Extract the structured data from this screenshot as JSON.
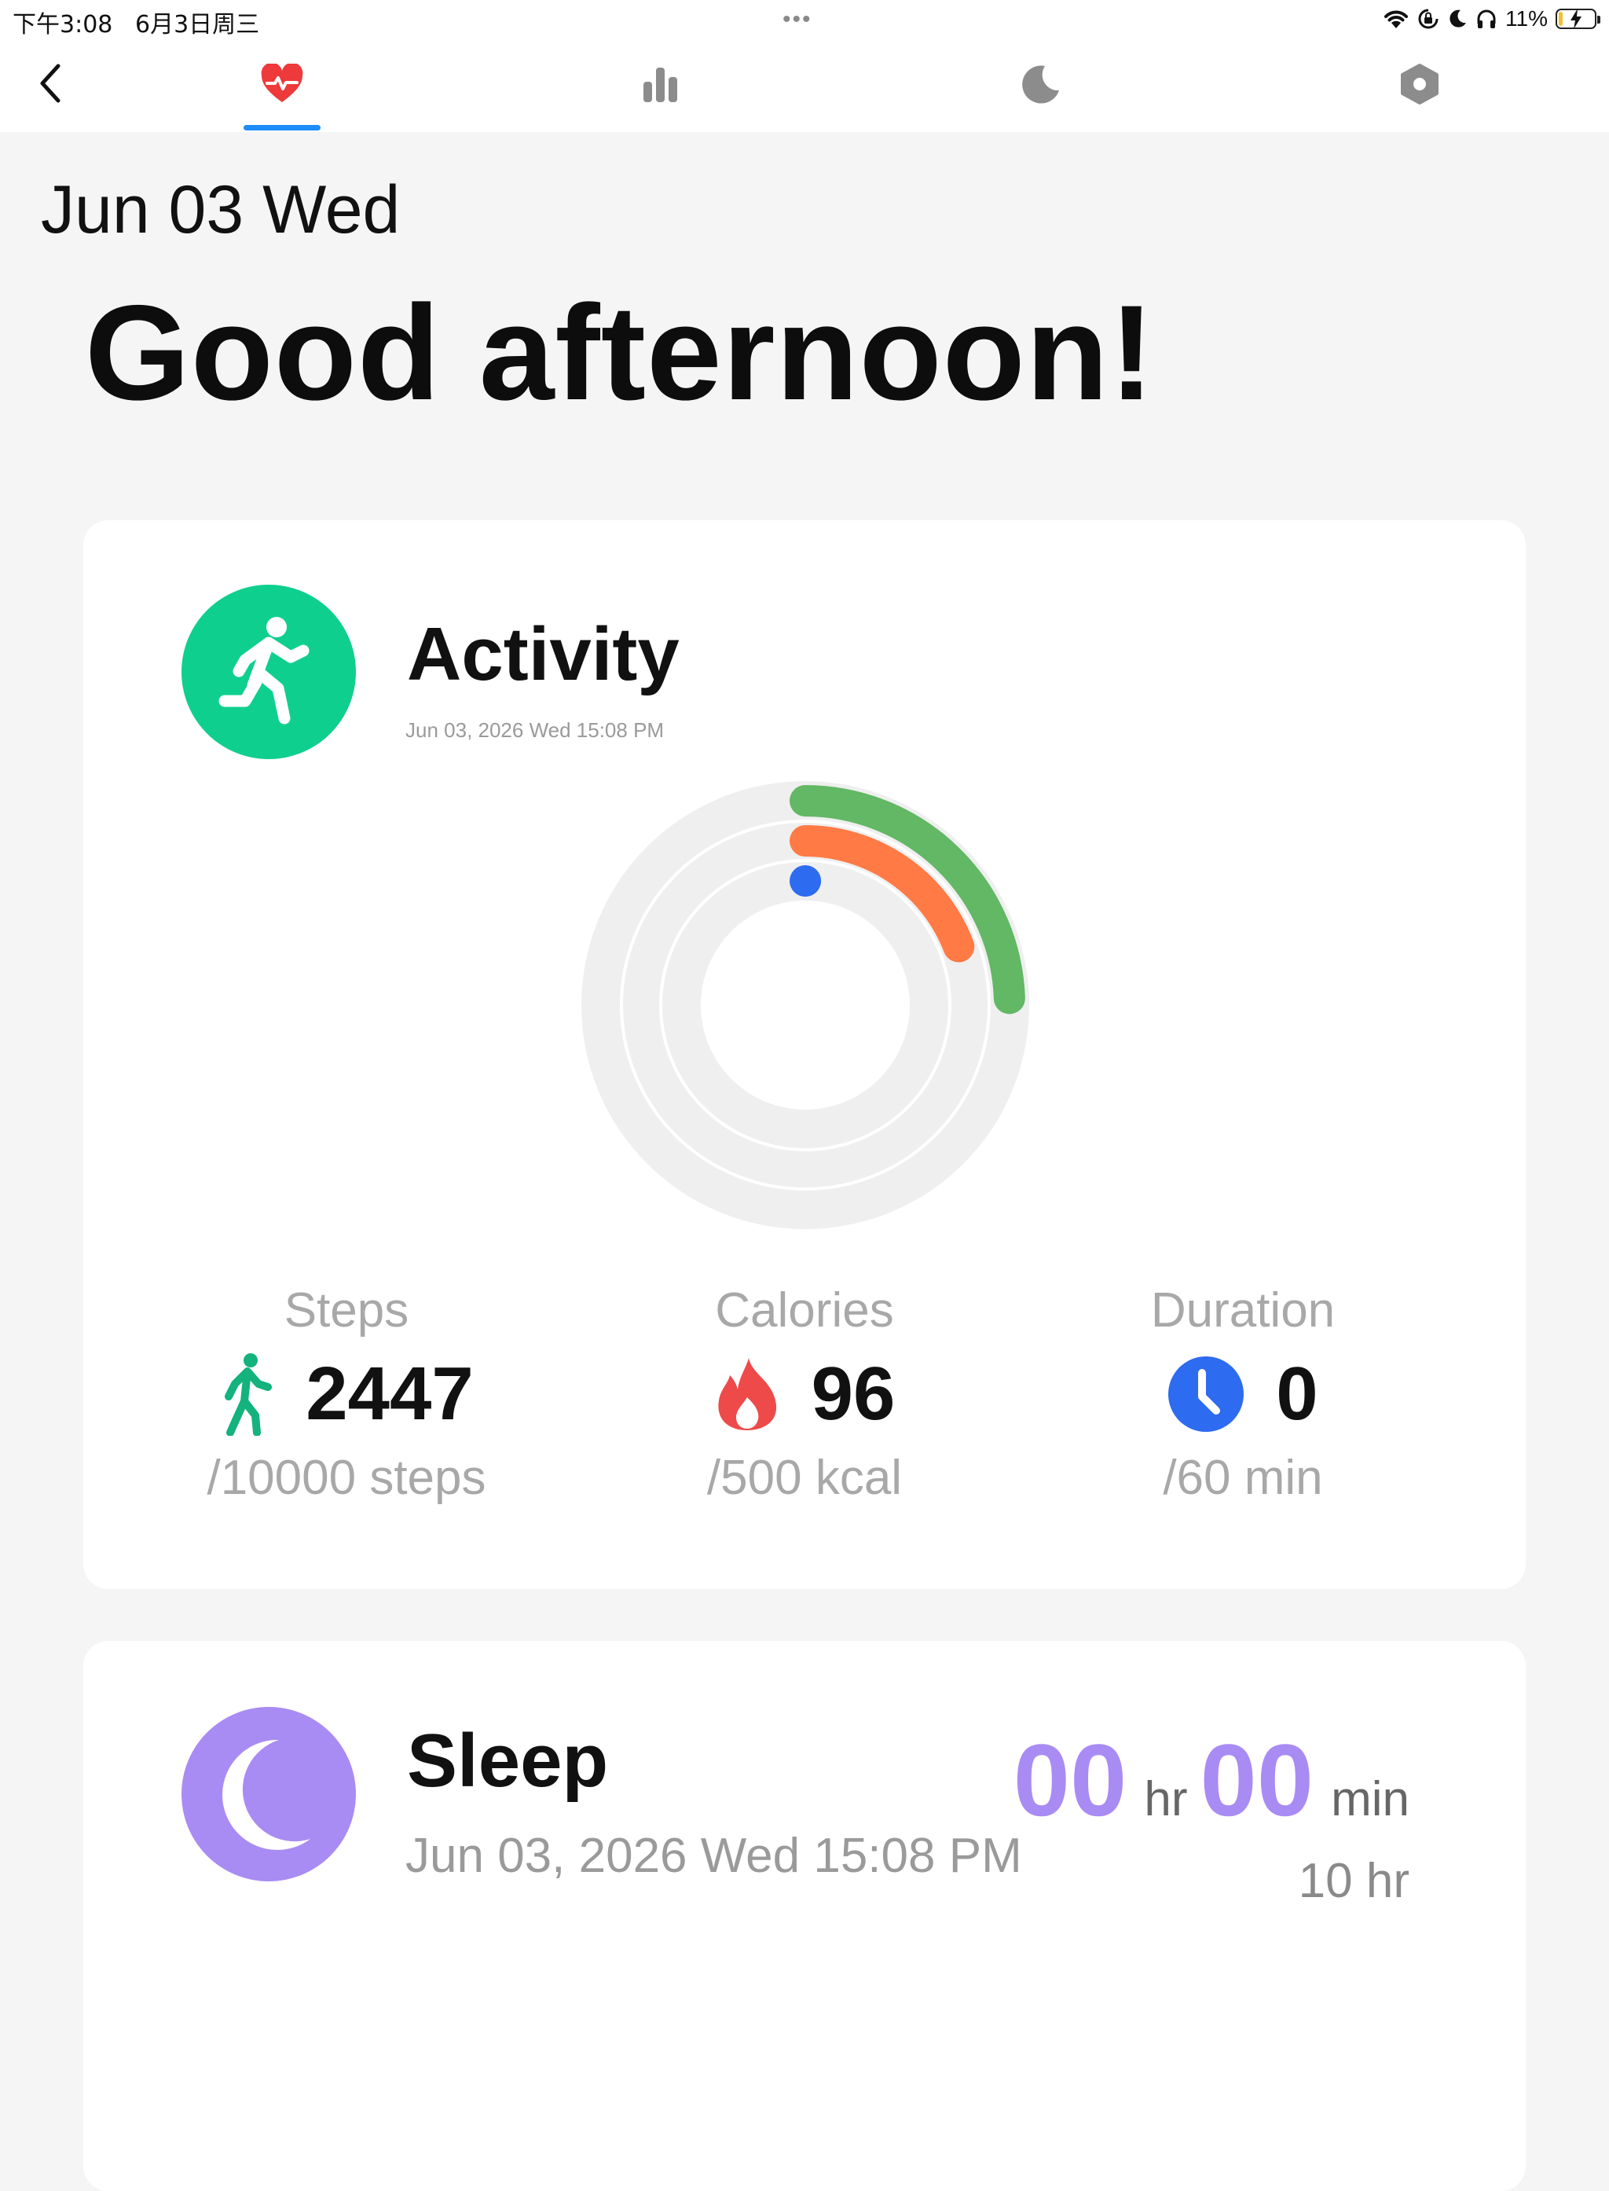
{
  "status_bar": {
    "time": "下午3:08",
    "date": "6月3日周三",
    "battery": "11%",
    "battery_level": 0.11
  },
  "nav": {
    "tabs": [
      "heart-rate",
      "statistics",
      "sleep",
      "settings"
    ],
    "active_tab": 0,
    "accent_color": "#1d8cf8"
  },
  "header": {
    "date": "Jun 03 Wed",
    "greeting": "Good afternoon!"
  },
  "activity": {
    "title": "Activity",
    "timestamp": "Jun 03, 2026 Wed 15:08 PM",
    "icon_color": "#0fcf8f",
    "rings": [
      {
        "metric": "steps",
        "progress": 0.2447,
        "color": "#62b864"
      },
      {
        "metric": "calories",
        "progress": 0.192,
        "color": "#ff7a45"
      },
      {
        "metric": "duration",
        "progress": 0.0,
        "color": "#2d6bf0"
      }
    ],
    "stats": {
      "steps": {
        "label": "Steps",
        "value": "2447",
        "goal": "/10000 steps",
        "icon_color": "#14b27d"
      },
      "calories": {
        "label": "Calories",
        "value": "96",
        "goal": "/500 kcal",
        "icon_color": "#ee4a4a"
      },
      "duration": {
        "label": "Duration",
        "value": "0",
        "goal": "/60 min",
        "icon_color": "#2d6bf0"
      }
    }
  },
  "sleep": {
    "title": "Sleep",
    "timestamp": "Jun 03, 2026 Wed 15:08 PM",
    "icon_color": "#a98bf4",
    "hours": "00",
    "hours_unit": "hr",
    "minutes": "00",
    "minutes_unit": "min",
    "goal": "10 hr"
  }
}
